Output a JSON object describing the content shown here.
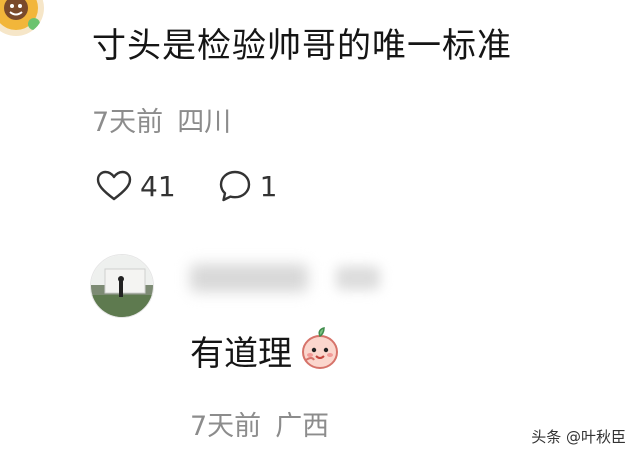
{
  "comment": {
    "text": "寸头是检验帅哥的唯一标准",
    "time": "7天前",
    "location": "四川",
    "likes": "41",
    "replies": "1"
  },
  "reply": {
    "text": "有道理",
    "time": "7天前",
    "location": "广西"
  },
  "watermark": "头条 @叶秋臣",
  "colors": {
    "text": "#151515",
    "meta": "#8c8c8c",
    "background": "#ffffff"
  }
}
